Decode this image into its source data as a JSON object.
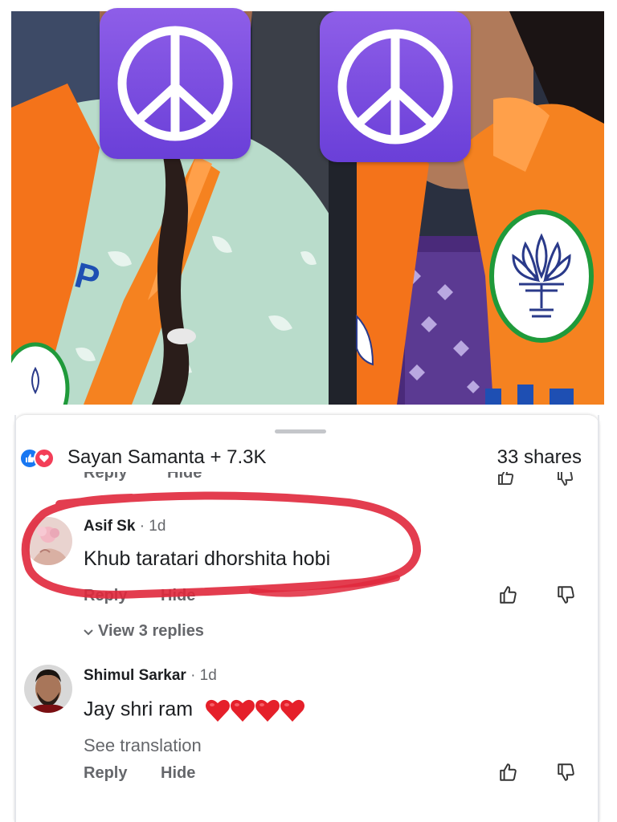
{
  "post": {
    "reactions_summary": "Sayan Samanta + 7.3K",
    "shares": "33 shares",
    "cut_reply": "Reply",
    "cut_hide": "Hide"
  },
  "comments": [
    {
      "author": "Asif Sk",
      "time": "· 1d",
      "text": "Khub taratari dhorshita hobi",
      "reply_label": "Reply",
      "hide_label": "Hide",
      "view_replies": "View 3 replies"
    },
    {
      "author": "Shimul Sarkar",
      "time": "· 1d",
      "text": "Jay shri ram",
      "see_translation": "See translation",
      "reply_label": "Reply",
      "hide_label": "Hide"
    }
  ],
  "colors": {
    "like_blue": "#1877f2",
    "love_red": "#f33e58",
    "annotation_red": "#e0283c",
    "peace_purple": "#7b4fe0",
    "saffron": "#f4731a"
  },
  "icons": [
    "peace-symbol-icon",
    "like-reaction-icon",
    "love-reaction-icon",
    "thumbs-up-icon",
    "thumbs-down-icon",
    "chevron-down-icon",
    "heart-emoji-icon"
  ]
}
